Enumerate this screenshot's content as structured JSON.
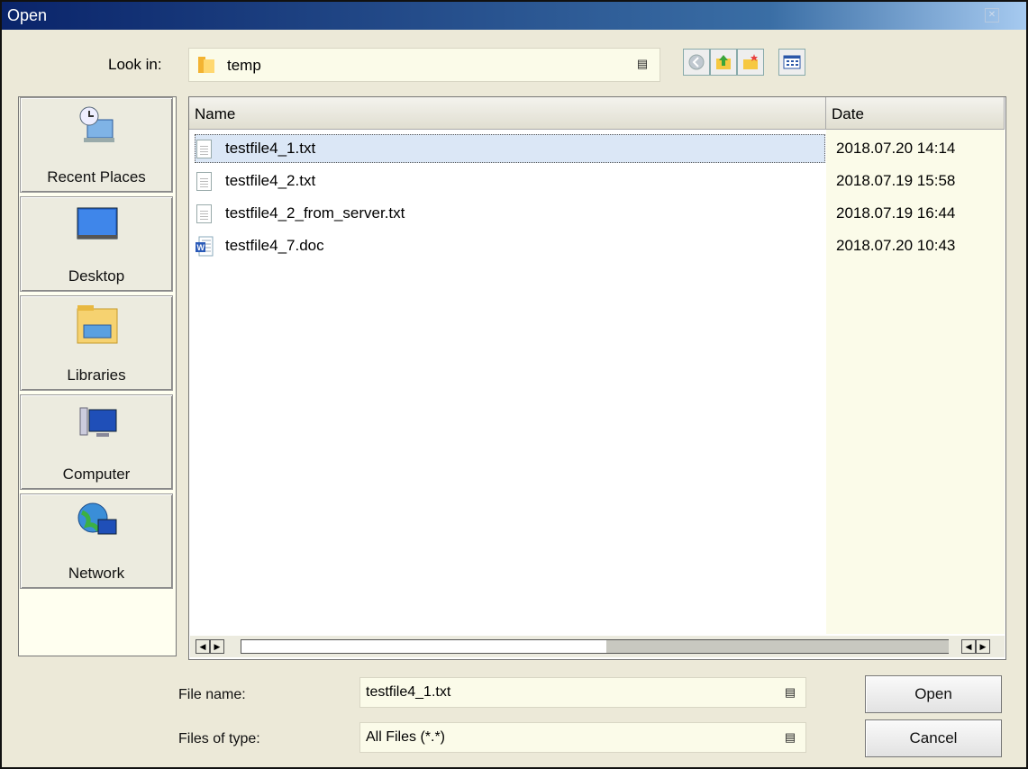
{
  "window": {
    "title": "Open"
  },
  "lookin": {
    "label": "Look in:",
    "value": "temp"
  },
  "places": [
    {
      "label": "Recent Places",
      "icon": "recent-places-icon"
    },
    {
      "label": "Desktop",
      "icon": "desktop-icon"
    },
    {
      "label": "Libraries",
      "icon": "libraries-icon"
    },
    {
      "label": "Computer",
      "icon": "computer-icon"
    },
    {
      "label": "Network",
      "icon": "network-icon"
    }
  ],
  "filelist": {
    "columns": [
      "Name",
      "Date"
    ],
    "rows": [
      {
        "name": "testfile4_1.txt",
        "date": "2018.07.20 14:14",
        "icon": "text-file-icon",
        "selected": true
      },
      {
        "name": "testfile4_2.txt",
        "date": "2018.07.19 15:58",
        "icon": "text-file-icon"
      },
      {
        "name": "testfile4_2_from_server.txt",
        "date": "2018.07.19 16:44",
        "icon": "text-file-icon"
      },
      {
        "name": "testfile4_7.doc",
        "date": "2018.07.20 10:43",
        "icon": "word-doc-icon"
      }
    ]
  },
  "filename": {
    "label": "File name:",
    "value": "testfile4_1.txt"
  },
  "filetype": {
    "label": "Files of type:",
    "value": "All Files (*.*)"
  },
  "buttons": {
    "open": "Open",
    "cancel": "Cancel"
  },
  "colors": {
    "titlebar": "#0a246a",
    "selection": "#dbe7f6",
    "field_bg": "#fbfbe9"
  }
}
